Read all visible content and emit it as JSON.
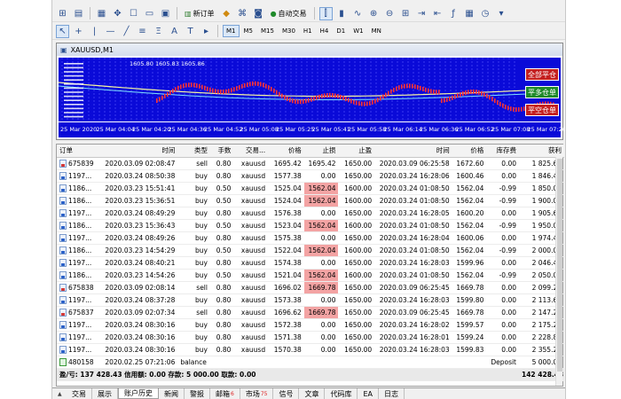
{
  "toolbar": {
    "new_order_label": "新订单",
    "autotrading_label": "自动交易",
    "timeframes": [
      "M1",
      "M5",
      "M15",
      "M30",
      "H1",
      "H4",
      "D1",
      "W1",
      "MN"
    ]
  },
  "chart_window": {
    "title": "XAUUSD,M1",
    "info_line": "1605.80 1605.83 1605.86",
    "trade_buttons": [
      "全部平仓",
      "平多仓单",
      "平空仓单"
    ],
    "time_axis": [
      "25 Mar 2020",
      "25 Mar 04:04",
      "25 Mar 04:20",
      "25 Mar 04:36",
      "25 Mar 04:52",
      "25 Mar 05:08",
      "25 Mar 05:25",
      "25 Mar 05:41",
      "25 Mar 05:58",
      "25 Mar 06:14",
      "25 Mar 06:36",
      "25 Mar 06:52",
      "25 Mar 07:08",
      "25 Mar 07:26"
    ]
  },
  "terminal": {
    "headers": [
      "订单",
      "时间",
      "类型",
      "手数",
      "交易...",
      "价格",
      "止损",
      "止盈",
      "时间",
      "价格",
      "库存费",
      "获利"
    ],
    "rows": [
      {
        "icon": "sell",
        "c": [
          "675839",
          "2020.03.09 02:08:47",
          "sell",
          "0.80",
          "xauusd",
          "1695.42",
          "1695.42",
          "1650.00",
          "2020.03.09 06:25:58",
          "1672.60",
          "0.00",
          "1 825.60"
        ],
        "hl": false
      },
      {
        "icon": "buy",
        "c": [
          "1197...",
          "2020.03.24 08:50:38",
          "buy",
          "0.80",
          "xauusd",
          "1577.38",
          "0.00",
          "1650.00",
          "2020.03.24 16:28:06",
          "1600.46",
          "0.00",
          "1 846.40"
        ],
        "hl": false
      },
      {
        "icon": "buy",
        "c": [
          "1186...",
          "2020.03.23 15:51:41",
          "buy",
          "0.50",
          "xauusd",
          "1525.04",
          "1562.04",
          "1600.00",
          "2020.03.24 01:08:50",
          "1562.04",
          "-0.99",
          "1 850.00"
        ],
        "hl": true
      },
      {
        "icon": "buy",
        "c": [
          "1186...",
          "2020.03.23 15:36:51",
          "buy",
          "0.50",
          "xauusd",
          "1524.04",
          "1562.04",
          "1600.00",
          "2020.03.24 01:08:50",
          "1562.04",
          "-0.99",
          "1 900.00"
        ],
        "hl": true
      },
      {
        "icon": "buy",
        "c": [
          "1197...",
          "2020.03.24 08:49:29",
          "buy",
          "0.80",
          "xauusd",
          "1576.38",
          "0.00",
          "1650.00",
          "2020.03.24 16:28:05",
          "1600.20",
          "0.00",
          "1 905.60"
        ],
        "hl": false
      },
      {
        "icon": "buy",
        "c": [
          "1186...",
          "2020.03.23 15:36:43",
          "buy",
          "0.50",
          "xauusd",
          "1523.04",
          "1562.04",
          "1600.00",
          "2020.03.24 01:08:50",
          "1562.04",
          "-0.99",
          "1 950.00"
        ],
        "hl": true
      },
      {
        "icon": "buy",
        "c": [
          "1197...",
          "2020.03.24 08:49:26",
          "buy",
          "0.80",
          "xauusd",
          "1575.38",
          "0.00",
          "1650.00",
          "2020.03.24 16:28:04",
          "1600.06",
          "0.00",
          "1 974.40"
        ],
        "hl": false
      },
      {
        "icon": "buy",
        "c": [
          "1186...",
          "2020.03.23 14:54:29",
          "buy",
          "0.50",
          "xauusd",
          "1522.04",
          "1562.04",
          "1600.00",
          "2020.03.24 01:08:50",
          "1562.04",
          "-0.99",
          "2 000.00"
        ],
        "hl": true
      },
      {
        "icon": "buy",
        "c": [
          "1197...",
          "2020.03.24 08:40:21",
          "buy",
          "0.80",
          "xauusd",
          "1574.38",
          "0.00",
          "1650.00",
          "2020.03.24 16:28:03",
          "1599.96",
          "0.00",
          "2 046.40"
        ],
        "hl": false
      },
      {
        "icon": "buy",
        "c": [
          "1186...",
          "2020.03.23 14:54:26",
          "buy",
          "0.50",
          "xauusd",
          "1521.04",
          "1562.04",
          "1600.00",
          "2020.03.24 01:08:50",
          "1562.04",
          "-0.99",
          "2 050.00"
        ],
        "hl": true
      },
      {
        "icon": "sell",
        "c": [
          "675838",
          "2020.03.09 02:08:14",
          "sell",
          "0.80",
          "xauusd",
          "1696.02",
          "1669.78",
          "1650.00",
          "2020.03.09 06:25:45",
          "1669.78",
          "0.00",
          "2 099.20"
        ],
        "hl": true
      },
      {
        "icon": "buy",
        "c": [
          "1197...",
          "2020.03.24 08:37:28",
          "buy",
          "0.80",
          "xauusd",
          "1573.38",
          "0.00",
          "1650.00",
          "2020.03.24 16:28:03",
          "1599.80",
          "0.00",
          "2 113.60"
        ],
        "hl": false
      },
      {
        "icon": "sell",
        "c": [
          "675837",
          "2020.03.09 02:07:34",
          "sell",
          "0.80",
          "xauusd",
          "1696.62",
          "1669.78",
          "1650.00",
          "2020.03.09 06:25:45",
          "1669.78",
          "0.00",
          "2 147.20"
        ],
        "hl": true
      },
      {
        "icon": "buy",
        "c": [
          "1197...",
          "2020.03.24 08:30:16",
          "buy",
          "0.80",
          "xauusd",
          "1572.38",
          "0.00",
          "1650.00",
          "2020.03.24 16:28:02",
          "1599.57",
          "0.00",
          "2 175.20"
        ],
        "hl": false
      },
      {
        "icon": "buy",
        "c": [
          "1197...",
          "2020.03.24 08:30:16",
          "buy",
          "0.80",
          "xauusd",
          "1571.38",
          "0.00",
          "1650.00",
          "2020.03.24 16:28:01",
          "1599.24",
          "0.00",
          "2 228.80"
        ],
        "hl": false
      },
      {
        "icon": "buy",
        "c": [
          "1197...",
          "2020.03.24 08:30:16",
          "buy",
          "0.80",
          "xauusd",
          "1570.38",
          "0.00",
          "1650.00",
          "2020.03.24 16:28:03",
          "1599.83",
          "0.00",
          "2 355.20"
        ],
        "hl": false
      }
    ],
    "balance_row": {
      "order": "480158",
      "time": "2020.02.25 07:21:06",
      "type": "balance",
      "comment": "Deposit",
      "amount": "5 000.00"
    },
    "total_line": "盈/亏: 137 428.43  信用额: 0.00  存款: 5 000.00  取款: 0.00",
    "total_value": "142 428.43"
  },
  "bottom_tabs": [
    {
      "label": "交易",
      "selected": false,
      "badge": ""
    },
    {
      "label": "展示",
      "selected": false,
      "badge": ""
    },
    {
      "label": "账户历史",
      "selected": true,
      "badge": ""
    },
    {
      "label": "新闻",
      "selected": false,
      "badge": ""
    },
    {
      "label": "警报",
      "selected": false,
      "badge": ""
    },
    {
      "label": "邮箱",
      "selected": false,
      "badge": "6"
    },
    {
      "label": "市场",
      "selected": false,
      "badge": "75"
    },
    {
      "label": "信号",
      "selected": false,
      "badge": ""
    },
    {
      "label": "文章",
      "selected": false,
      "badge": ""
    },
    {
      "label": "代码库",
      "selected": false,
      "badge": ""
    },
    {
      "label": "EA",
      "selected": false,
      "badge": ""
    },
    {
      "label": "日志",
      "selected": false,
      "badge": ""
    }
  ],
  "colors": {
    "chart_bg": "#0a0ad8",
    "sl_highlight": "#f3a3a3",
    "btn_close_all": "#c41f1f",
    "btn_close_long": "#1f8a2a",
    "btn_close_short": "#c41f1f"
  }
}
